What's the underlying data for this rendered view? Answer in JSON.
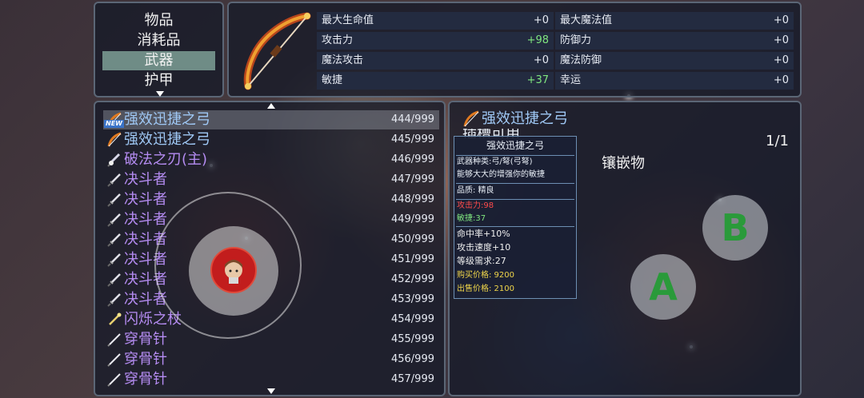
{
  "categories": {
    "items": [
      {
        "label": "物品"
      },
      {
        "label": "消耗品"
      },
      {
        "label": "武器"
      },
      {
        "label": "护甲"
      }
    ],
    "selected_index": 2
  },
  "stats": {
    "rows": [
      {
        "left_label": "最大生命值",
        "left_value": "+0",
        "right_label": "最大魔法值",
        "right_value": "+0"
      },
      {
        "left_label": "攻击力",
        "left_value": "+98",
        "right_label": "防御力",
        "right_value": "+0"
      },
      {
        "left_label": "魔法攻击",
        "left_value": "+0",
        "right_label": "魔法防御",
        "right_value": "+0"
      },
      {
        "left_label": "敏捷",
        "left_value": "+37",
        "right_label": "幸运",
        "right_value": "+0"
      }
    ]
  },
  "item_list": {
    "new_badge": "NEW",
    "items": [
      {
        "name": "强效迅捷之弓",
        "count": "444/999",
        "icon": "bow-icon"
      },
      {
        "name": "强效迅捷之弓",
        "count": "445/999",
        "icon": "bow-icon"
      },
      {
        "name": "破法之刃(主)",
        "count": "446/999",
        "icon": "blade-icon"
      },
      {
        "name": "决斗者",
        "count": "447/999",
        "icon": "sword-icon"
      },
      {
        "name": "决斗者",
        "count": "448/999",
        "icon": "sword-icon"
      },
      {
        "name": "决斗者",
        "count": "449/999",
        "icon": "sword-icon"
      },
      {
        "name": "决斗者",
        "count": "450/999",
        "icon": "sword-icon"
      },
      {
        "name": "决斗者",
        "count": "451/999",
        "icon": "sword-icon"
      },
      {
        "name": "决斗者",
        "count": "452/999",
        "icon": "sword-icon"
      },
      {
        "name": "决斗者",
        "count": "453/999",
        "icon": "sword-icon"
      },
      {
        "name": "闪烁之杖",
        "count": "454/999",
        "icon": "staff-icon"
      },
      {
        "name": "穿骨针",
        "count": "455/999",
        "icon": "needle-icon"
      },
      {
        "name": "穿骨针",
        "count": "456/999",
        "icon": "needle-icon"
      },
      {
        "name": "穿骨针",
        "count": "457/999",
        "icon": "needle-icon"
      }
    ]
  },
  "detail": {
    "title": "强效迅捷之弓",
    "subtitle_partial": "插槽可用",
    "page": "1/1",
    "socket_label": "镶嵌物",
    "tooltip": {
      "name": "强效迅捷之弓",
      "type": "武器种类:弓/弩(弓弩)",
      "desc": "能够大大的增强你的敏捷",
      "quality": "品质: 精良",
      "attack": "攻击力:98",
      "agility": "敏捷:37",
      "hit": "命中率+10%",
      "speed": "攻击速度+10",
      "level": "等级需求:27",
      "buy": "购买价格: 9200",
      "sell": "出售价格: 2100"
    }
  },
  "controls": {
    "a_label": "A",
    "b_label": "B"
  },
  "colors": {
    "item_name": "#b58cf2",
    "title": "#9fc8f5",
    "positive": "#7fe57f",
    "attack_red": "#ff4b4b",
    "agility_green": "#7fe57f",
    "price_yellow": "#f0d64a"
  }
}
